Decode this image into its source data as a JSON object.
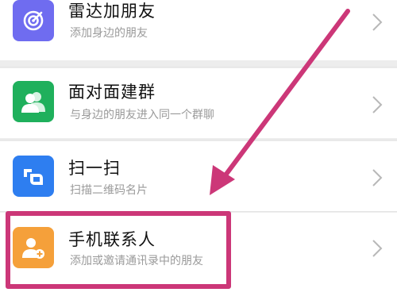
{
  "items": [
    {
      "title": "雷达加朋友",
      "subtitle": "添加身边的朋友",
      "icon": "radar-icon",
      "color": "#6f6cf0"
    },
    {
      "title": "面对面建群",
      "subtitle": "与身边的朋友进入同一个群聊",
      "icon": "group-people-icon",
      "color": "#1fb05c"
    },
    {
      "title": "扫一扫",
      "subtitle": "扫描二维码名片",
      "icon": "scan-icon",
      "color": "#2e7ef0"
    },
    {
      "title": "手机联系人",
      "subtitle": "添加或邀请通讯录中的朋友",
      "icon": "add-contact-icon",
      "color": "#f5a03a"
    }
  ],
  "annotation": {
    "color": "#cc3778"
  }
}
